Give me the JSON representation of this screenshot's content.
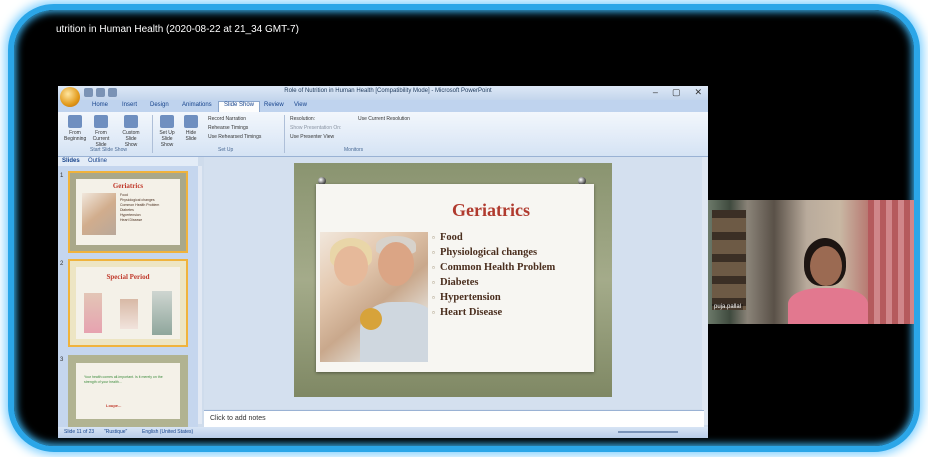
{
  "recording": {
    "title": "utrition in Human Health (2020-08-22 at 21_34 GMT-7)"
  },
  "powerpoint": {
    "window_title": "Role of Nutrition in Human Health [Compatibility Mode] - Microsoft PowerPoint",
    "window_controls": [
      "–",
      "▢",
      "✕"
    ],
    "tabs": [
      "Home",
      "Insert",
      "Design",
      "Animations",
      "Slide Show",
      "Review",
      "View"
    ],
    "active_tab": "Slide Show",
    "ribbon": {
      "buttons": [
        "From Beginning",
        "From Current Slide",
        "Custom Slide Show",
        "Set Up Slide Show",
        "Hide Slide"
      ],
      "options": [
        "Record Narration",
        "Rehearse Timings",
        "Use Rehearsed Timings"
      ],
      "monitor_options": [
        "Resolution:",
        "Use Current Resolution",
        "Show Presentation On:",
        "Use Presenter View"
      ],
      "groups": [
        "Start Slide Show",
        "Set Up",
        "Monitors"
      ]
    },
    "panel_tabs": [
      "Slides",
      "Outline"
    ],
    "thumbnails": [
      {
        "number": "1",
        "title": "Geriatrics",
        "items": [
          "Food",
          "Physiological changes",
          "Common Health Problem",
          "Diabetes",
          "Hypertension",
          "Heart Disease"
        ]
      },
      {
        "number": "2",
        "title": "Special Period"
      },
      {
        "number": "3",
        "text": "Your health comes all-important. Is it merely on the strength of your health...",
        "author": "Loupe..."
      }
    ],
    "slide": {
      "title": "Geriatrics",
      "bullets": [
        "Food",
        "Physiological changes",
        "Common Health Problem",
        "Diabetes",
        "Hypertension",
        "Heart Disease"
      ]
    },
    "notes_placeholder": "Click to add notes",
    "status": {
      "slide_info": "Slide 11 of 23",
      "theme": "\"Rustique\"",
      "language": "English (United States)"
    }
  },
  "webcam": {
    "name": "puja.pallal"
  },
  "colors": {
    "frame_border": "#2ba6e8",
    "slide_title": "#b03a2e",
    "ribbon": "#d5e3f4"
  }
}
